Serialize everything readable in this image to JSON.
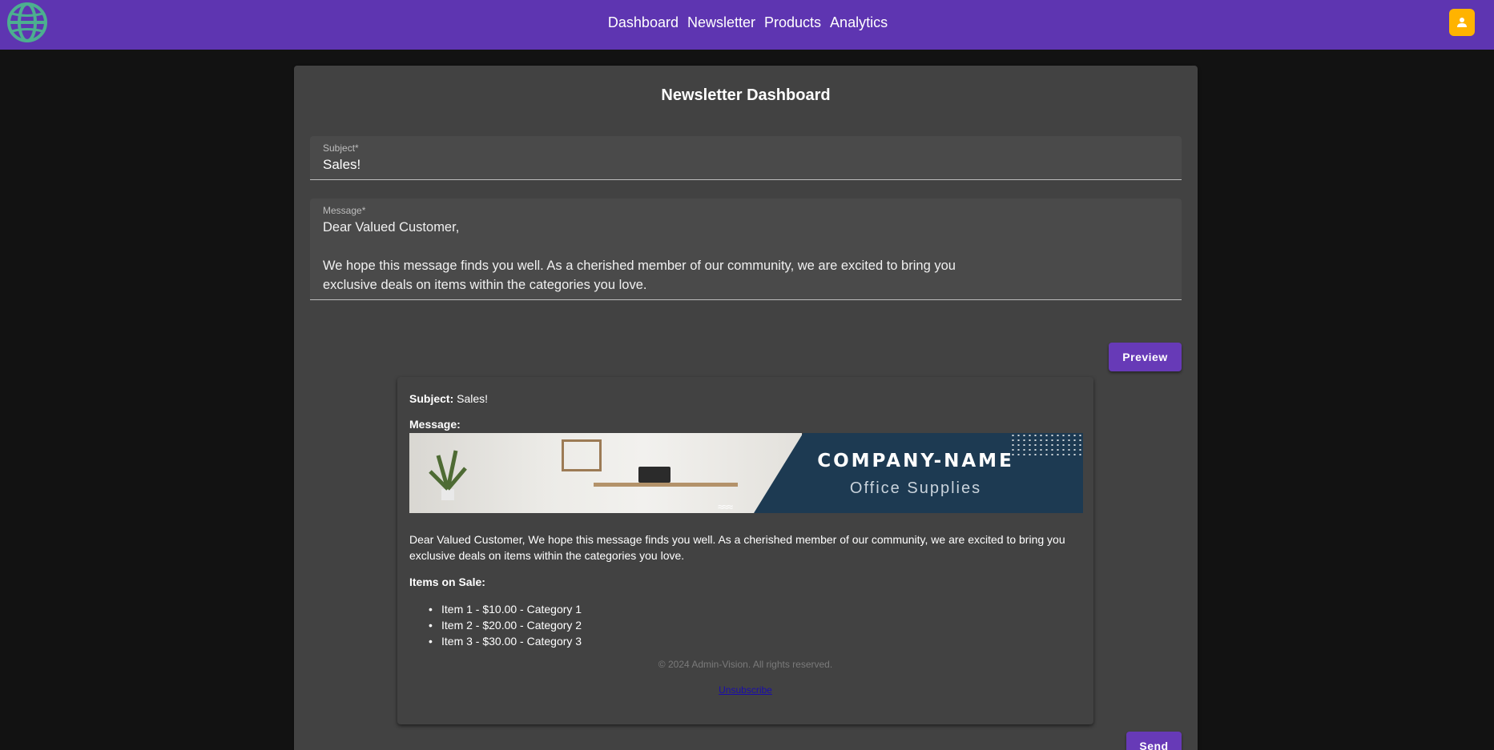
{
  "nav": {
    "links": [
      "Dashboard",
      "Newsletter",
      "Products",
      "Analytics"
    ],
    "logo_icon": "globe-icon",
    "user_icon": "user-icon"
  },
  "colors": {
    "topbar": "#5e35b1",
    "button": "#673ab7",
    "user_button": "#ffb300",
    "card": "#424242",
    "background": "#121212"
  },
  "page": {
    "title": "Newsletter Dashboard"
  },
  "form": {
    "subject_label": "Subject*",
    "subject_value": "Sales!",
    "message_label": "Message*",
    "message_value": "Dear Valued Customer,\n\nWe hope this message finds you well. As a cherished member of our community, we are excited to bring you\nexclusive deals on items within the categories you love.",
    "preview_button": "Preview",
    "send_button": "Send"
  },
  "preview": {
    "subject_label": "Subject:",
    "subject_value": "Sales!",
    "message_label": "Message:",
    "banner_company": "COMPANY-NAME",
    "banner_tagline": "Office Supplies",
    "body": "Dear Valued Customer, We hope this message finds you well. As a cherished member of our community, we are excited to bring you exclusive deals on items within the categories you love.",
    "items_title": "Items on Sale:",
    "items": [
      "Item 1 - $10.00 - Category 1",
      "Item 2 - $20.00 - Category 2",
      "Item 3 - $30.00 - Category 3"
    ],
    "footer": "© 2024 Admin-Vision. All rights reserved.",
    "unsubscribe": "Unsubscribe"
  }
}
